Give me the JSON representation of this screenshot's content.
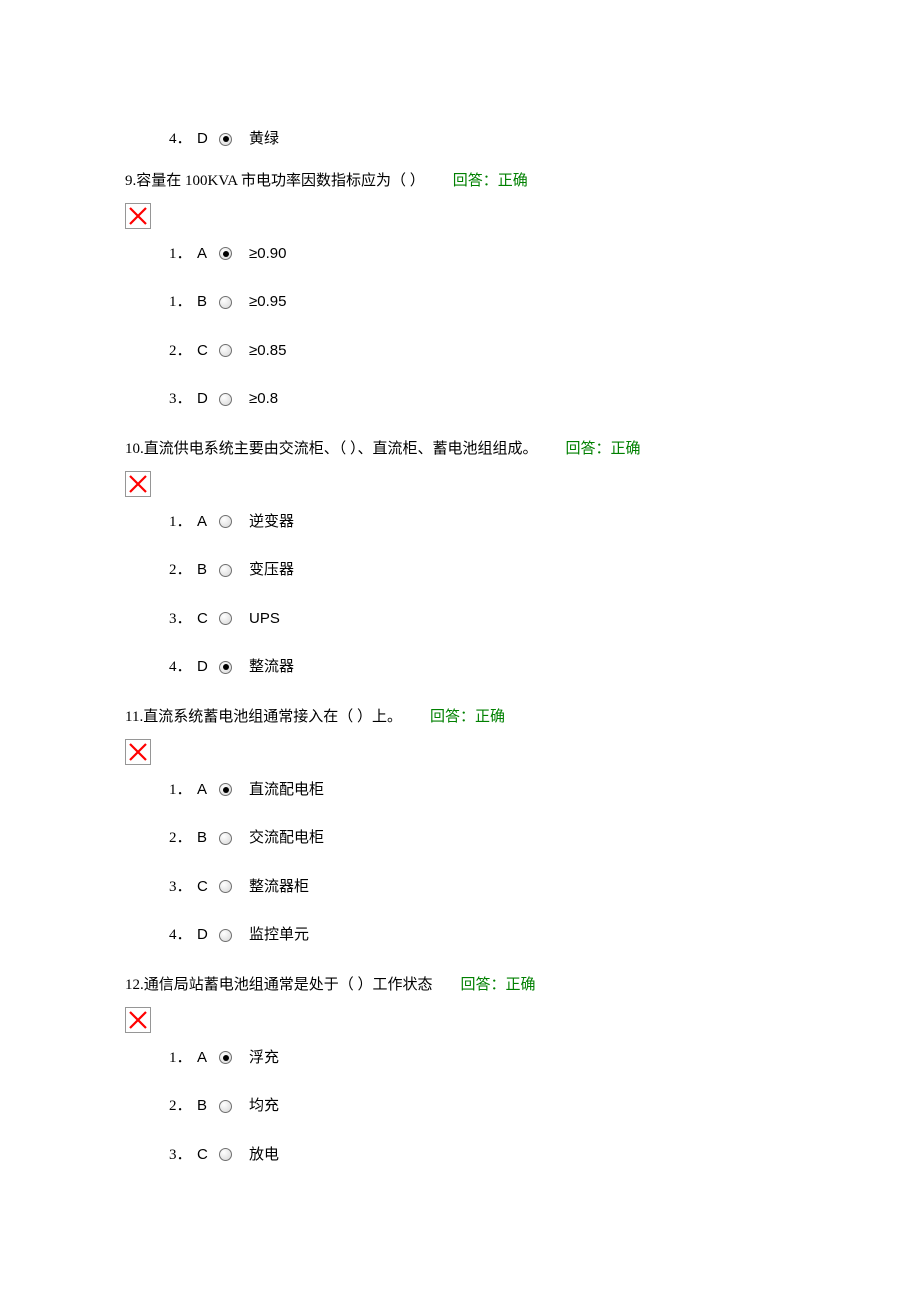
{
  "lead_option": {
    "num": "4．",
    "letter": "D",
    "selected": true,
    "text": "黄绿"
  },
  "questions": [
    {
      "number": "9.",
      "text": "容量在 100KVA 市电功率因数指标应为（ ）",
      "feedback": "回答：正确",
      "options": [
        {
          "num": "1．",
          "letter": "A",
          "selected": true,
          "text": "≥0.90"
        },
        {
          "num": "1．",
          "letter": "B",
          "selected": false,
          "text": "≥0.95"
        },
        {
          "num": "2．",
          "letter": "C",
          "selected": false,
          "text": "≥0.85"
        },
        {
          "num": "3．",
          "letter": "D",
          "selected": false,
          "text": "≥0.8"
        }
      ]
    },
    {
      "number": "10.",
      "text": "直流供电系统主要由交流柜、（ ）、直流柜、蓄电池组组成。",
      "feedback": "回答：正确",
      "options": [
        {
          "num": "1．",
          "letter": "A",
          "selected": false,
          "text": "逆变器"
        },
        {
          "num": "2．",
          "letter": "B",
          "selected": false,
          "text": "变压器"
        },
        {
          "num": "3．",
          "letter": "C",
          "selected": false,
          "text": "UPS"
        },
        {
          "num": "4．",
          "letter": "D",
          "selected": true,
          "text": "整流器"
        }
      ]
    },
    {
      "number": "11.",
      "text": "直流系统蓄电池组通常接入在（ ）上。",
      "feedback": "回答：正确",
      "options": [
        {
          "num": "1．",
          "letter": "A",
          "selected": true,
          "text": "直流配电柜"
        },
        {
          "num": "2．",
          "letter": "B",
          "selected": false,
          "text": "交流配电柜"
        },
        {
          "num": "3．",
          "letter": "C",
          "selected": false,
          "text": "整流器柜"
        },
        {
          "num": "4．",
          "letter": "D",
          "selected": false,
          "text": "监控单元"
        }
      ]
    },
    {
      "number": "12.",
      "text": "通信局站蓄电池组通常是处于（ ）工作状态",
      "feedback": "回答：正确",
      "options": [
        {
          "num": "1．",
          "letter": "A",
          "selected": true,
          "text": "浮充"
        },
        {
          "num": "2．",
          "letter": "B",
          "selected": false,
          "text": "均充"
        },
        {
          "num": "3．",
          "letter": "C",
          "selected": false,
          "text": "放电"
        }
      ]
    }
  ]
}
